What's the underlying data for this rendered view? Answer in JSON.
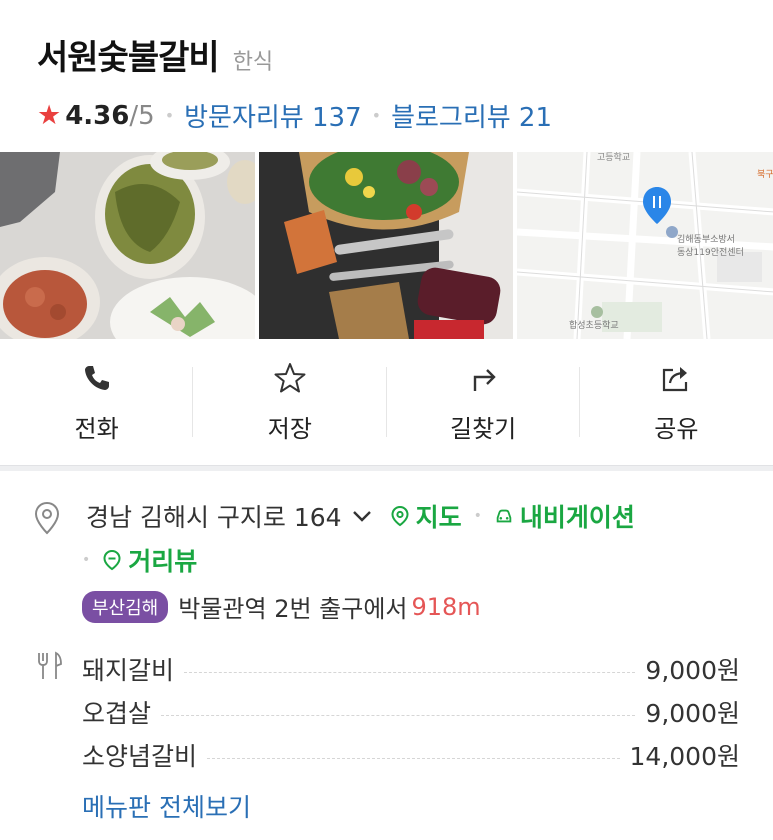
{
  "header": {
    "title": "서원숯불갈비",
    "category": "한식",
    "rating_score": "4.36",
    "rating_max": "/5",
    "visitor_review_label": "방문자리뷰 137",
    "blog_review_label": "블로그리뷰 21"
  },
  "photos": {
    "map_labels": [
      "고등학교",
      "김해동부소방서",
      "동상119안전센터",
      "합성초등학교",
      "북구"
    ]
  },
  "actions": [
    {
      "label": "전화",
      "icon": "phone-icon"
    },
    {
      "label": "저장",
      "icon": "star-outline-icon"
    },
    {
      "label": "길찾기",
      "icon": "directions-arrow-icon"
    },
    {
      "label": "공유",
      "icon": "share-icon"
    }
  ],
  "address": {
    "text": "경남 김해시 구지로 164",
    "map_link": "지도",
    "navi_link": "내비게이션",
    "street_view_link": "거리뷰"
  },
  "subway": {
    "line_badge": "부산김해",
    "station_text": "박물관역 2번 출구에서",
    "distance": "918m"
  },
  "menu": {
    "items": [
      {
        "name": "돼지갈비",
        "price": "9,000원"
      },
      {
        "name": "오겹살",
        "price": "9,000원"
      },
      {
        "name": "소양념갈비",
        "price": "14,000원"
      }
    ],
    "more_link": "메뉴판 전체보기"
  },
  "colors": {
    "star": "#e9403f",
    "link_blue": "#2a6fb5",
    "green": "#1aa742",
    "subway_purple": "#7a4fa3",
    "distance_red": "#e55656"
  }
}
